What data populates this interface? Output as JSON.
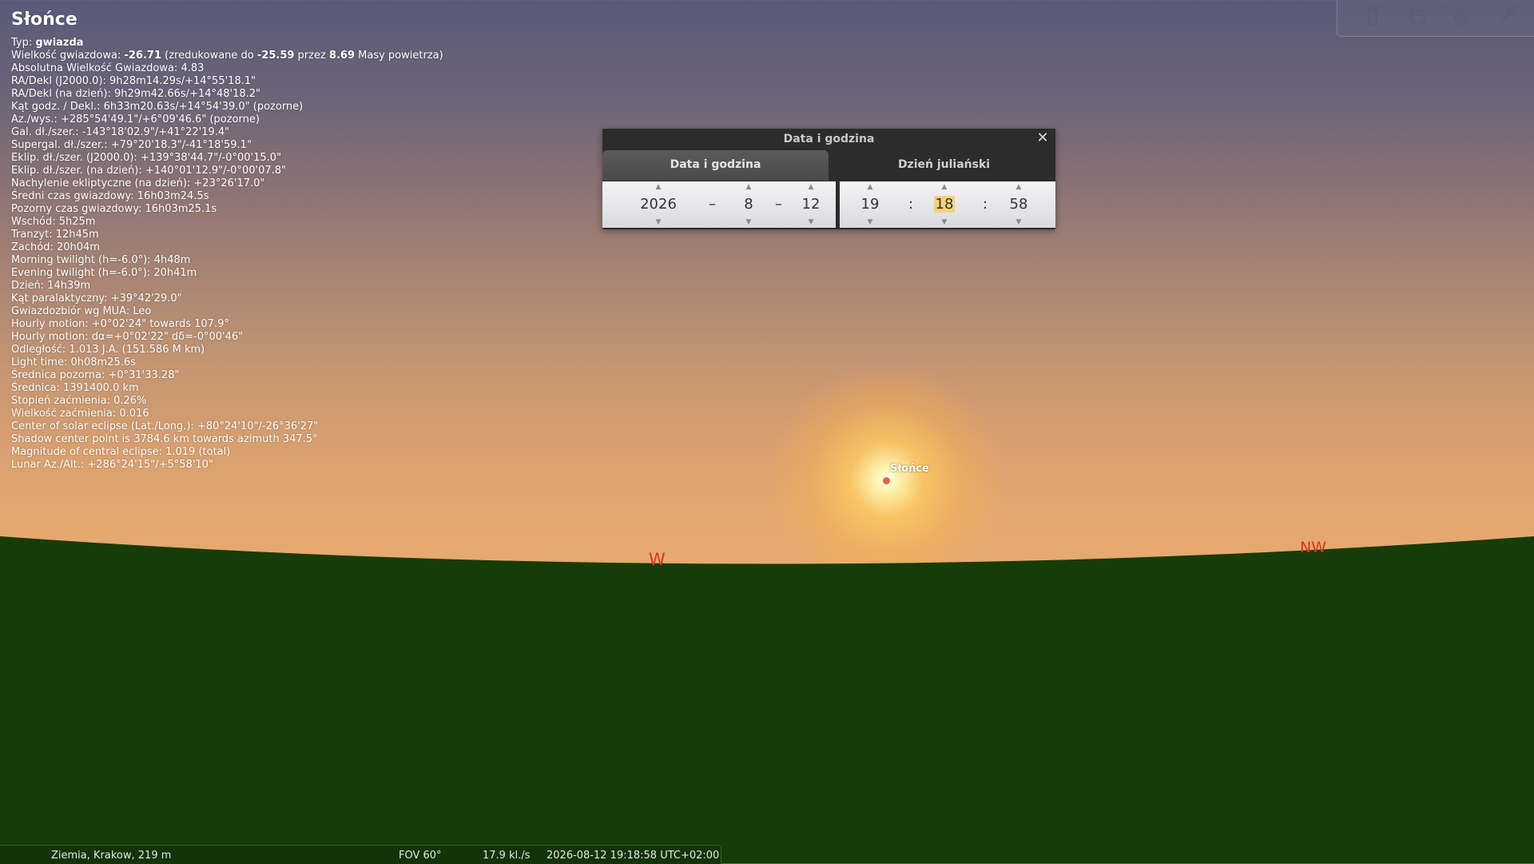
{
  "object_info": {
    "title": "Słońce",
    "lines": [
      {
        "label": "Typ: ",
        "value": "gwiazda"
      },
      {
        "label": "Wielkość gwiazdowa: ",
        "value": "-26.71",
        "suffix": " (zredukowane do ",
        "value2": "-25.59",
        "suffix2": " przez ",
        "value3": "8.69",
        "suffix3": " Masy powietrza)"
      },
      {
        "label": "Absolutna Wielkość Gwiazdowa: 4.83"
      },
      {
        "label": "RA/Dekl (J2000.0): 9h28m14.29s/+14°55'18.1\""
      },
      {
        "label": "RA/Dekl (na dzień): 9h29m42.66s/+14°48'18.2\""
      },
      {
        "label": "Kąt godz. / Dekl.: 6h33m20.63s/+14°54'39.0\" (pozorne)"
      },
      {
        "label": "Az./wys.: +285°54'49.1\"/+6°09'46.6\" (pozorne)"
      },
      {
        "label": "Gal. dł./szer.: -143°18'02.9\"/+41°22'19.4\""
      },
      {
        "label": "Supergal. dł./szer.: +79°20'18.3\"/-41°18'59.1\""
      },
      {
        "label": "Eklip. dł./szer. (J2000.0): +139°38'44.7\"/-0°00'15.0\""
      },
      {
        "label": "Eklip. dł./szer. (na dzień): +140°01'12.9\"/-0°00'07.8\""
      },
      {
        "label": "Nachylenie ekliptyczne (na dzień): +23°26'17.0\""
      },
      {
        "label": "Średni czas gwiazdowy: 16h03m24.5s"
      },
      {
        "label": "Pozorny czas gwiazdowy: 16h03m25.1s"
      },
      {
        "label": "Wschód: 5h25m"
      },
      {
        "label": "Tranzyt: 12h45m"
      },
      {
        "label": "Zachód: 20h04m"
      },
      {
        "label": "Morning twilight (h=-6.0°): 4h48m"
      },
      {
        "label": "Evening twilight (h=-6.0°): 20h41m"
      },
      {
        "label": "Dzień: 14h39m"
      },
      {
        "label": "Kąt paralaktyczny: +39°42'29.0\""
      },
      {
        "label": "Gwiazdozbiór wg MUA: Leo"
      },
      {
        "label": "Hourly motion: +0°02'24\" towards 107.9°"
      },
      {
        "label": "Hourly motion: dα=+0°02'22\" dδ=-0°00'46\""
      },
      {
        "label": "Odległość: 1.013 J.A. (151.586 M km)"
      },
      {
        "label": "Light time: 0h08m25.6s"
      },
      {
        "label": "Średnica pozorna: +0°31'33.28\""
      },
      {
        "label": "Średnica: 1391400.0 km"
      },
      {
        "label": "Stopień zaćmienia: 0.26%"
      },
      {
        "label": "Wielkość zaćmienia: 0.016"
      },
      {
        "label": "Center of solar eclipse (Lat./Long.): +80°24'10\"/-26°36'27\""
      },
      {
        "label": "Shadow center point is 3784.6 km towards azimuth 347.5°"
      },
      {
        "label": "Magnitude of central eclipse: 1.019 (total)"
      },
      {
        "label": "Lunar Az./Alt.: +286°24'15\"/+5°58'10\""
      }
    ]
  },
  "sky": {
    "sun_label": "Słońce",
    "cardinal_w": "W",
    "cardinal_nw": "NW",
    "ground_color": "#173c07",
    "cardinal_color": "#d8321e"
  },
  "toolbar": {
    "icons": [
      "scroll-icon",
      "planet-icon",
      "target-icon",
      "wrench-icon"
    ]
  },
  "dialog": {
    "title": "Data i godzina",
    "close": "✕",
    "tabs": [
      "Data i godzina",
      "Dzień juliański"
    ],
    "date": {
      "year": "2026",
      "month": "8",
      "day": "12",
      "sep": "–"
    },
    "time": {
      "hour": "19",
      "minute": "18",
      "second": "58",
      "sep": ":"
    },
    "up_arrow": "▲",
    "down_arrow": "▼"
  },
  "status_bar": {
    "location": "Ziemia, Krakow, 219 m",
    "fov": "FOV 60°",
    "fps": "17.9 kl./s",
    "datetime": "2026-08-12 19:18:58 UTC+02:00"
  }
}
